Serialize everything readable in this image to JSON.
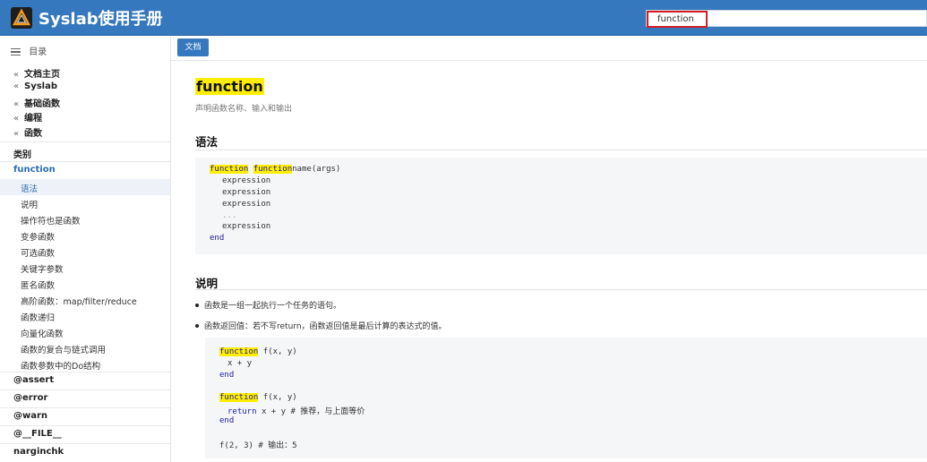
{
  "header": {
    "title": "Syslab使用手册",
    "search_value": "function",
    "accent": "#3578bd"
  },
  "sidebar": {
    "toc_label": "目录",
    "breadcrumbs": [
      "文档主页",
      "Syslab",
      "基础函数",
      "编程",
      "函数"
    ],
    "category_label": "类别",
    "active_item": "function",
    "sub_items": [
      "语法",
      "说明",
      "操作符也是函数",
      "变参函数",
      "可选函数",
      "关键字参数",
      "匿名函数",
      "高阶函数：map/filter/reduce",
      "函数递归",
      "向量化函数",
      "函数的复合与链式调用",
      "函数参数中的Do结构"
    ],
    "selected_sub": "语法",
    "other_items": [
      "@assert",
      "@error",
      "@warn",
      "@__FILE__",
      "narginchk"
    ]
  },
  "toolbar": {
    "doc_button": "文档"
  },
  "main": {
    "title": "function",
    "subtitle": "声明函数名称、输入和输出",
    "syntax_heading": "语法",
    "syntax_code": {
      "line1_kw": "function",
      "line1_name_kw": "function",
      "line1_rest": "name(args)",
      "body": [
        "expression",
        "expression",
        "expression",
        "...",
        "expression"
      ],
      "end": "end"
    },
    "desc_heading": "说明",
    "bullets": [
      "函数是一组一起执行一个任务的语句。",
      "函数返回值：若不写return，函数返回值是最后计算的表达式的值。"
    ],
    "example_code": {
      "fn_kw": "function",
      "sig1": "f(x, y)",
      "body1": "x + y",
      "end1": "end",
      "sig2": "f(x, y)",
      "ret_kw": "return",
      "body2": "x + y # 推荐，与上面等价",
      "end2": "end",
      "call": "f(2, 3) # 输出：5"
    }
  }
}
